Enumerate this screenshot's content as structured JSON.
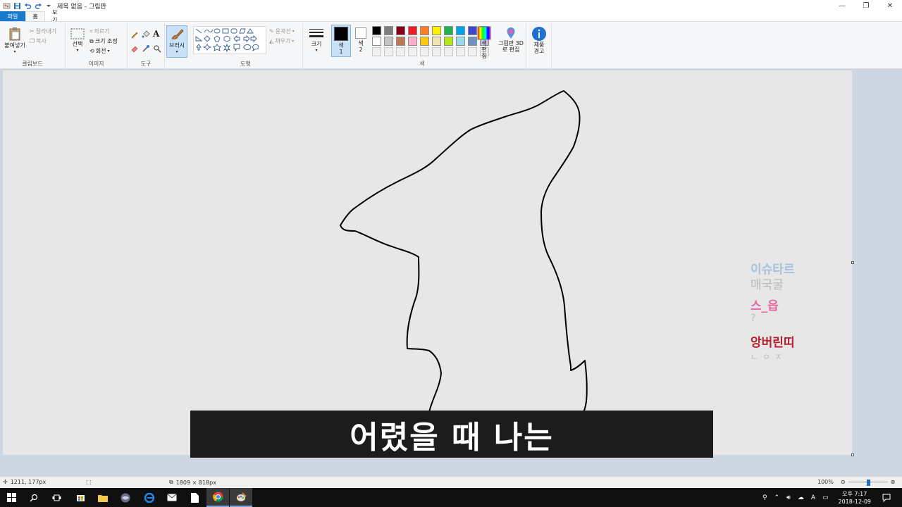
{
  "window": {
    "title": "제목 없음 - 그림판",
    "controls": {
      "minimize": "—",
      "restore": "❐",
      "close": "✕"
    }
  },
  "tabs": [
    {
      "label": "파일"
    },
    {
      "label": "홈"
    },
    {
      "label": "보기"
    }
  ],
  "ribbon": {
    "clipboard": {
      "label": "클립보드",
      "paste": "붙여넣기",
      "cut": "잘라내기",
      "copy": "복사"
    },
    "image": {
      "label": "이미지",
      "select": "선택",
      "crop": "자르기",
      "resize": "크기 조정",
      "rotate": "회전"
    },
    "tools": {
      "label": "도구"
    },
    "brushes": {
      "label": "브러시"
    },
    "shapes": {
      "label": "도형",
      "outline": "윤곽선",
      "fill": "채우기"
    },
    "size": {
      "label": "크기"
    },
    "color1": {
      "label": "색 1"
    },
    "color2": {
      "label": "색 2"
    },
    "colors": {
      "label": "색",
      "edit": "색 편집"
    },
    "paint3d": {
      "label": "그림판 3D로 편집"
    },
    "product_alert": {
      "label": "제품 경고"
    }
  },
  "palette": {
    "row1": [
      "#000000",
      "#7f7f7f",
      "#880015",
      "#ed1c24",
      "#ff7f27",
      "#fff200",
      "#22b14c",
      "#00a2e8",
      "#3f48cc",
      "#a349a4"
    ],
    "row2": [
      "#ffffff",
      "#c3c3c3",
      "#b97a57",
      "#ffaec9",
      "#ffc90e",
      "#efe4b0",
      "#b5e61d",
      "#99d9ea",
      "#7092be",
      "#c8bfe7"
    ],
    "row3": [
      "#f0f0f0",
      "#f0f0f0",
      "#f0f0f0",
      "#f0f0f0",
      "#f0f0f0",
      "#f0f0f0",
      "#f0f0f0",
      "#f0f0f0",
      "#f0f0f0",
      "#f0f0f0"
    ],
    "color1": "#000000",
    "color2": "#ffffff"
  },
  "canvas": {
    "subtitle": "어렸을 때 나는",
    "watermark": [
      {
        "text": "이슈타르",
        "color": "#a9c1dc"
      },
      {
        "text": "매국굴",
        "color": "#b9b9b9"
      },
      {
        "text": "스_읍",
        "color": "#e46aa0"
      },
      {
        "text": "?",
        "color": "#b9b9b9"
      },
      {
        "text": "앙버린띠",
        "color": "#b3222e"
      },
      {
        "text": "ㄴㅇㅈ",
        "color": "#b9b9b9"
      }
    ]
  },
  "status": {
    "cursor": "1211, 177px",
    "canvas_size": "1809 × 818px",
    "zoom": "100%"
  },
  "taskbar": {
    "clock_time": "오후 7:17",
    "clock_date": "2018-12-09",
    "ime": "A"
  }
}
